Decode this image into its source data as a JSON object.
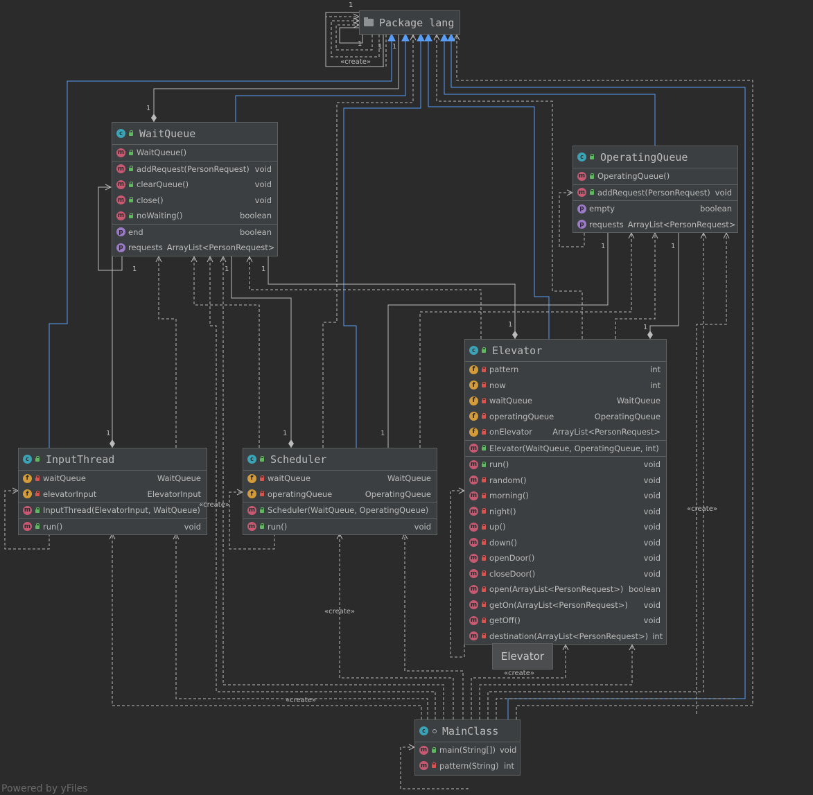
{
  "package": {
    "title": "Package lang"
  },
  "classes": {
    "waitqueue": {
      "name": "WaitQueue",
      "constructors": [
        {
          "name": "WaitQueue()",
          "type": ""
        }
      ],
      "methods": [
        {
          "name": "addRequest(PersonRequest)",
          "type": "void"
        },
        {
          "name": "clearQueue()",
          "type": "void"
        },
        {
          "name": "close()",
          "type": "void"
        },
        {
          "name": "noWaiting()",
          "type": "boolean"
        }
      ],
      "properties": [
        {
          "name": "end",
          "type": "boolean"
        },
        {
          "name": "requests",
          "type": "ArrayList<PersonRequest>"
        }
      ]
    },
    "operatingqueue": {
      "name": "OperatingQueue",
      "constructors": [
        {
          "name": "OperatingQueue()",
          "type": ""
        }
      ],
      "methods": [
        {
          "name": "addRequest(PersonRequest)",
          "type": "void"
        }
      ],
      "properties": [
        {
          "name": "empty",
          "type": "boolean"
        },
        {
          "name": "requests",
          "type": "ArrayList<PersonRequest>"
        }
      ]
    },
    "elevator": {
      "name": "Elevator",
      "fields": [
        {
          "name": "pattern",
          "type": "int"
        },
        {
          "name": "now",
          "type": "int"
        },
        {
          "name": "waitQueue",
          "type": "WaitQueue"
        },
        {
          "name": "operatingQueue",
          "type": "OperatingQueue"
        },
        {
          "name": "onElevator",
          "type": "ArrayList<PersonRequest>"
        }
      ],
      "constructors": [
        {
          "name": "Elevator(WaitQueue, OperatingQueue, int)",
          "type": ""
        }
      ],
      "methods": [
        {
          "name": "run()",
          "type": "void"
        },
        {
          "name": "random()",
          "type": "void"
        },
        {
          "name": "morning()",
          "type": "void"
        },
        {
          "name": "night()",
          "type": "void"
        },
        {
          "name": "up()",
          "type": "void"
        },
        {
          "name": "down()",
          "type": "void"
        },
        {
          "name": "openDoor()",
          "type": "void"
        },
        {
          "name": "closeDoor()",
          "type": "void"
        },
        {
          "name": "open(ArrayList<PersonRequest>)",
          "type": "boolean"
        },
        {
          "name": "getOn(ArrayList<PersonRequest>)",
          "type": "void"
        },
        {
          "name": "getOff()",
          "type": "void"
        },
        {
          "name": "destination(ArrayList<PersonRequest>)",
          "type": "int"
        }
      ]
    },
    "inputthread": {
      "name": "InputThread",
      "fields": [
        {
          "name": "waitQueue",
          "type": "WaitQueue"
        },
        {
          "name": "elevatorInput",
          "type": "ElevatorInput"
        }
      ],
      "constructors": [
        {
          "name": "InputThread(ElevatorInput, WaitQueue)",
          "type": ""
        }
      ],
      "methods": [
        {
          "name": "run()",
          "type": "void"
        }
      ]
    },
    "scheduler": {
      "name": "Scheduler",
      "fields": [
        {
          "name": "waitQueue",
          "type": "WaitQueue"
        },
        {
          "name": "operatingQueue",
          "type": "OperatingQueue"
        }
      ],
      "constructors": [
        {
          "name": "Scheduler(WaitQueue, OperatingQueue)",
          "type": ""
        }
      ],
      "methods": [
        {
          "name": "run()",
          "type": "void"
        }
      ]
    },
    "mainclass": {
      "name": "MainClass",
      "methods": [
        {
          "name": "main(String[])",
          "type": "void"
        },
        {
          "name": "pattern(String)",
          "type": "int"
        }
      ]
    }
  },
  "labels": {
    "create": "«create»",
    "one": "1"
  },
  "tooltip": "Elevator",
  "footer": "Powered by yFiles"
}
